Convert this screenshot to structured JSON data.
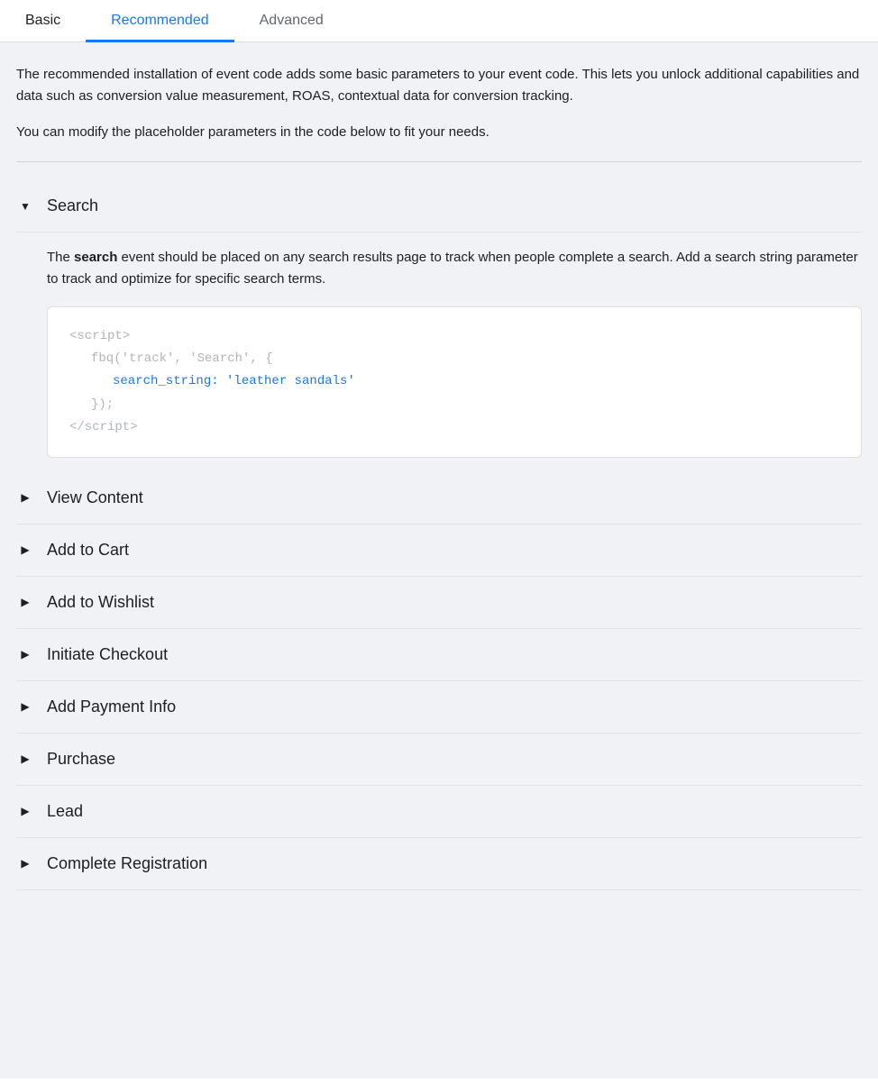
{
  "tabs": [
    {
      "id": "basic",
      "label": "Basic",
      "active": false
    },
    {
      "id": "recommended",
      "label": "Recommended",
      "active": true
    },
    {
      "id": "advanced",
      "label": "Advanced",
      "active": false
    }
  ],
  "description": {
    "line1": "The recommended installation of event code adds some basic parameters to your event code. This lets you unlock additional capabilities and data such as conversion value measurement, ROAS, contextual data for conversion tracking.",
    "line2": "You can modify the placeholder parameters in the code below to fit your needs."
  },
  "search_section": {
    "title": "Search",
    "expanded": true,
    "description_prefix": "The ",
    "description_bold": "search",
    "description_suffix": " event should be placed on any search results page to track when people complete a search. Add a search string parameter to track and optimize for specific search terms.",
    "code": {
      "line1": "<script>",
      "line2": "fbq('track', 'Search', {",
      "line3": "search_string: 'leather sandals'",
      "line4": "});",
      "line5": "</script>"
    }
  },
  "collapsed_items": [
    {
      "id": "view-content",
      "label": "View Content"
    },
    {
      "id": "add-to-cart",
      "label": "Add to Cart"
    },
    {
      "id": "add-to-wishlist",
      "label": "Add to Wishlist"
    },
    {
      "id": "initiate-checkout",
      "label": "Initiate Checkout"
    },
    {
      "id": "add-payment-info",
      "label": "Add Payment Info"
    },
    {
      "id": "purchase",
      "label": "Purchase"
    },
    {
      "id": "lead",
      "label": "Lead"
    },
    {
      "id": "complete-registration",
      "label": "Complete Registration"
    }
  ]
}
